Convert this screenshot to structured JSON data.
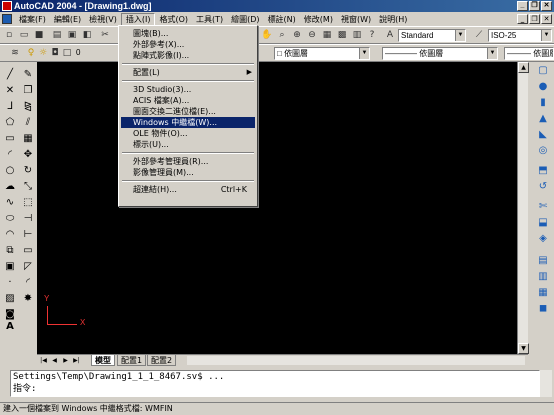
{
  "window": {
    "title": "AutoCAD 2004 - [Drawing1.dwg]",
    "minimize": "_",
    "restore": "❐",
    "close": "✕"
  },
  "menubar": {
    "items": [
      "檔案(F)",
      "編輯(E)",
      "檢視(V)",
      "插入(I)",
      "格式(O)",
      "工具(T)",
      "繪圖(D)",
      "標註(N)",
      "修改(M)",
      "視窗(W)",
      "說明(H)"
    ]
  },
  "toolbar": {
    "text_style": "Standard",
    "dim_style": "ISO-25",
    "layer": "0",
    "color": "依圖層",
    "linetype": "依圖層",
    "lineweight": "依圖層"
  },
  "insert_menu": {
    "items": [
      {
        "label": "圖塊(B)..."
      },
      {
        "label": "外部參考(X)..."
      },
      {
        "label": "點陣式影像(I)..."
      },
      {
        "label": "配置(L)",
        "submenu": "▶"
      },
      {
        "label": "3D Studio(3)..."
      },
      {
        "label": "ACIS 檔案(A)..."
      },
      {
        "label": "圖面交換二進位檔(E)..."
      },
      {
        "label": "Windows 中繼檔(W)..."
      },
      {
        "label": "OLE 物件(O)..."
      },
      {
        "label": "標示(U)..."
      },
      {
        "label": "外部參考管理員(R)..."
      },
      {
        "label": "影像管理員(M)..."
      },
      {
        "label": "超連結(H)...",
        "shortcut": "Ctrl+K"
      }
    ]
  },
  "drawing": {
    "ucs_x": "X",
    "ucs_y": "Y"
  },
  "layout_tabs": [
    "模型",
    "配置1",
    "配置2"
  ],
  "command": {
    "history": "Settings\\Temp\\Drawing1_1_1_8467.sv$ ...",
    "prompt": "指令:"
  },
  "status": "建入一個檔案到 Windows 中繼格式檔:  WMFIN",
  "colors": {
    "menu_highlight": "#0a246a",
    "canvas": "#000000",
    "ucs": "#e33333"
  }
}
